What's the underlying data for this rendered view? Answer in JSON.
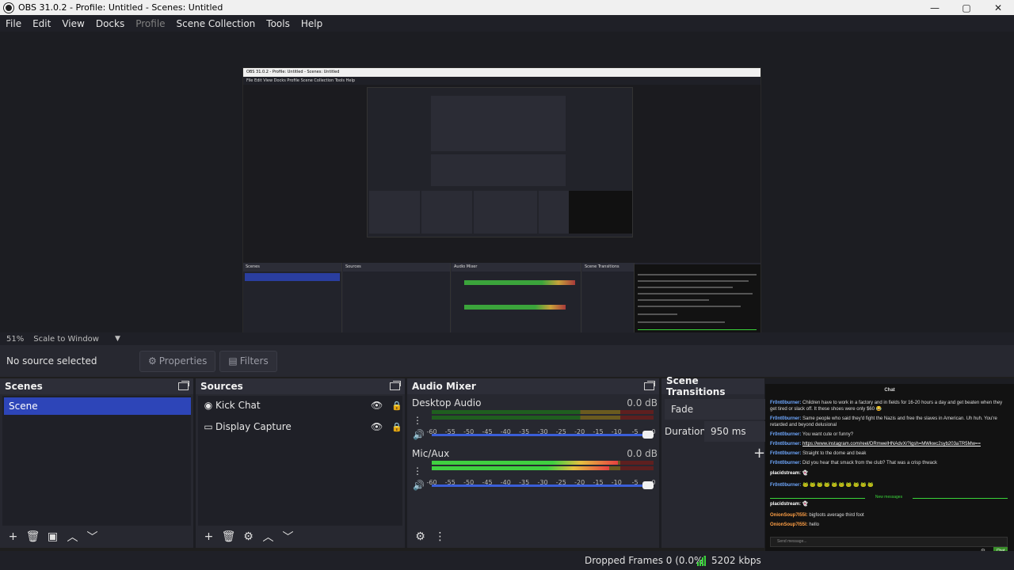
{
  "window": {
    "title": "OBS 31.0.2 - Profile: Untitled - Scenes: Untitled",
    "minimize": "—",
    "maximize": "▢",
    "close": "✕"
  },
  "menu": [
    "File",
    "Edit",
    "View",
    "Docks",
    "Profile",
    "Scene Collection",
    "Tools",
    "Help"
  ],
  "menu_disabled_index": 4,
  "preview": {
    "scale_percent": "51%",
    "scale_mode": "Scale to Window",
    "mini": {
      "title": "OBS 31.0.2 - Profile: Untitled - Scenes: Untitled",
      "menu": "File   Edit   View   Docks   Profile   Scene Collection   Tools   Help"
    }
  },
  "context_bar": {
    "no_source": "No source selected",
    "properties": "Properties",
    "filters": "Filters"
  },
  "scenes": {
    "title": "Scenes",
    "items": [
      "Scene"
    ]
  },
  "sources": {
    "title": "Sources",
    "items": [
      {
        "name": "Kick Chat",
        "icon": "globe-icon"
      },
      {
        "name": "Display Capture",
        "icon": "monitor-icon"
      }
    ]
  },
  "audio_mixer": {
    "title": "Audio Mixer",
    "channels": [
      {
        "name": "Desktop Audio",
        "db": "0.0 dB",
        "level": 0
      },
      {
        "name": "Mic/Aux",
        "db": "0.0 dB",
        "level": 0.84
      }
    ],
    "ticks": [
      "-60",
      "-55",
      "-50",
      "-45",
      "-40",
      "-35",
      "-30",
      "-25",
      "-20",
      "-15",
      "-10",
      "-5",
      "0"
    ]
  },
  "scene_transitions": {
    "title": "Scene Transitions",
    "transition": "Fade",
    "duration_label": "Duration",
    "duration_value": "950 ms"
  },
  "chat": {
    "title": "Chat",
    "messages": [
      {
        "user": "Fr0nt0burner:",
        "text": "Children have to work in a factory and in fields for 16-20 hours a day and get beaten when they get tired or slack off. It these shoes were only $60 😂"
      },
      {
        "user": "Fr0nt0burner:",
        "text": "Same people who said they'd fight the Nazis and free the slaves in American. Uh huh. You're retarded and beyond delusional"
      },
      {
        "user": "Fr0nt0burner:",
        "text": "You want cute or funny?"
      },
      {
        "user": "Fr0nt0burner:",
        "text": "https://www.instagram.com/reel/DRmwelHNAdvX/?igsh=MWkwc2syb203aTR5Mw=="
      },
      {
        "user": "Fr0nt0burner:",
        "text": "Straight to the dome and beak"
      },
      {
        "user": "Fr0nt0burner:",
        "text": "Did you hear that smack from the club? That was a crisp thwack"
      },
      {
        "user": "placidstream:",
        "text": "👻"
      },
      {
        "user": "Fr0nt0burner:",
        "text": "🐸 🐸 🐸 🐸 🐸 🐸 🐸 🐸 🐸 🐸"
      },
      {
        "user": "placidstream:",
        "text": "👻"
      },
      {
        "user": "OnionSoup7I55I:",
        "text": "bigfoots average third foot"
      },
      {
        "user": "OnionSoup7I55I:",
        "text": "hello"
      }
    ],
    "new_messages": "New messages",
    "input_placeholder": "Send message...",
    "send_label": "Chat"
  },
  "status": {
    "dropped_frames": "Dropped Frames 0 (0.0%)",
    "bitrate": "5202 kbps"
  },
  "colors": {
    "accent": "#2d45b8",
    "panel": "#272830",
    "bg": "#1c1d22"
  }
}
